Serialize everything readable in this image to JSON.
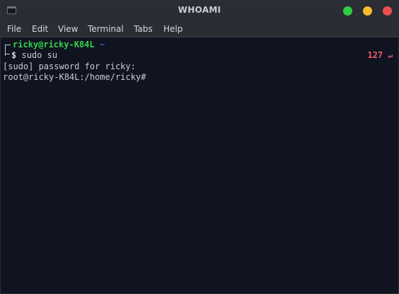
{
  "window": {
    "title": "WHOAMI",
    "controls": [
      "maximize",
      "minimize",
      "close"
    ],
    "icon": "terminal-icon"
  },
  "menubar": {
    "items": [
      "File",
      "Edit",
      "View",
      "Terminal",
      "Tabs",
      "Help"
    ]
  },
  "terminal": {
    "prompt_user": "ricky@ricky-K84L",
    "prompt_dir": "~",
    "prompt_symbol": "$",
    "command": "sudo su",
    "exit_code": "127",
    "return_icon": "↵",
    "output_lines": [
      "[sudo] password for ricky:",
      "root@ricky-K84L:/home/ricky#"
    ]
  },
  "colors": {
    "background": "#0f1420",
    "user": "#35d14a",
    "dir": "#3b82f6",
    "exit_code": "#f05a6e"
  }
}
